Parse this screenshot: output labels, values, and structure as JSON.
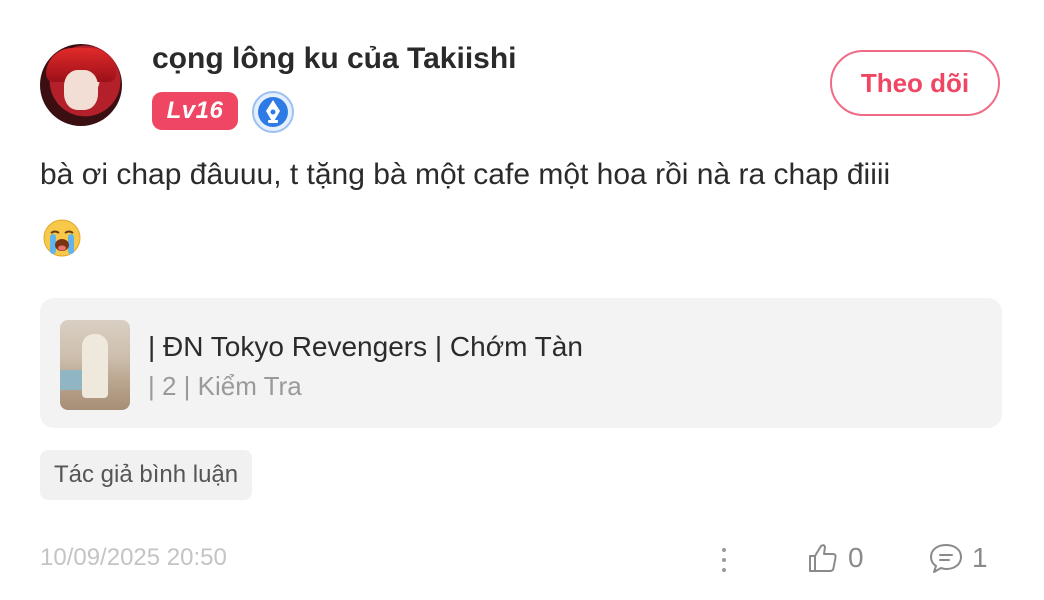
{
  "user": {
    "name": "cọng lông ku của Takiishi",
    "level": "Lv16",
    "avatar_icon": "avatar-red-hair",
    "badge_icon": "pen-nib-badge-icon"
  },
  "follow_button": {
    "label": "Theo dõi"
  },
  "comment": {
    "text": "bà ơi chap đâuuu, t tặng bà một cafe một hoa rồi nà ra chap điiii",
    "emoji_icon": "loudly-crying-face-icon"
  },
  "story": {
    "title": "| ĐN Tokyo Revengers | Chớm Tàn",
    "subtitle": "| 2 | Kiểm Tra"
  },
  "author_tag": "Tác giả bình luận",
  "footer": {
    "timestamp": "10/09/2025 20:50",
    "likes": "0",
    "replies": "1"
  },
  "colors": {
    "accent": "#ef4664",
    "badge_blue": "#2f7be6",
    "muted": "#c4c4c4"
  }
}
